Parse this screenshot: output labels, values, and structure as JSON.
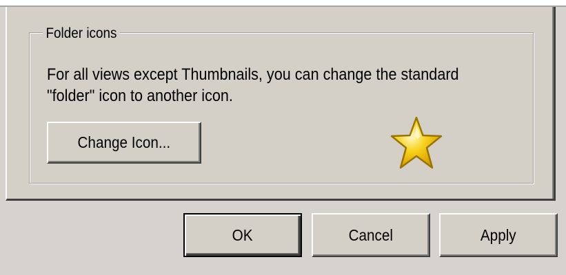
{
  "group": {
    "title": "Folder icons",
    "description_line1": "For all views except Thumbnails, you can change the standard",
    "description_line2": "\"folder\" icon to another icon.",
    "change_icon_label": "Change Icon...",
    "preview_icon": "star-icon"
  },
  "dialog_buttons": {
    "ok_label": "OK",
    "cancel_label": "Cancel",
    "apply_label": "Apply"
  },
  "colors": {
    "dialog_background": "#d4d0c8",
    "star_fill": "#f7d21b",
    "star_outline": "#9a7400"
  }
}
